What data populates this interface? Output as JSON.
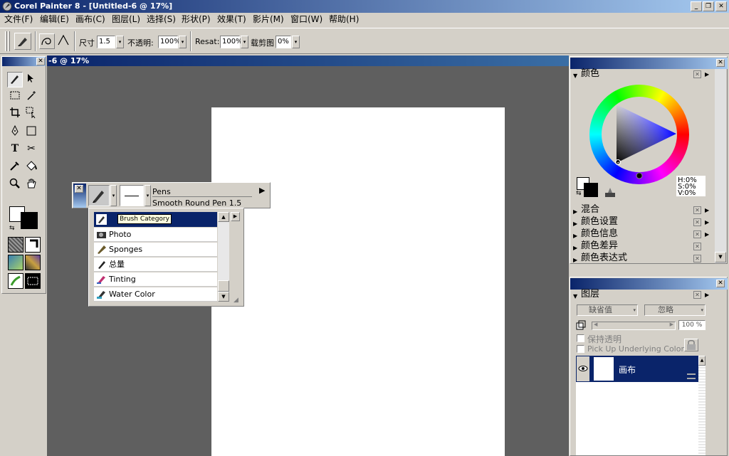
{
  "window": {
    "title": "Corel Painter 8 - [Untitled-6 @ 17%]",
    "controls": [
      "_",
      "❐",
      "✕"
    ]
  },
  "menu": [
    "文件(F)",
    "编辑(E)",
    "画布(C)",
    "图层(L)",
    "选择(S)",
    "形状(P)",
    "效果(T)",
    "影片(M)",
    "窗口(W)",
    "帮助(H)"
  ],
  "propbar": {
    "size_label": "尺寸",
    "size_value": "1.5",
    "opacity_label": "不透明:",
    "opacity_value": "100%",
    "resat_label": "Resat:",
    "resat_value": "100%",
    "bleed_label": "载剪图",
    "bleed_value": "0%"
  },
  "document": {
    "title": "-6 @ 17%"
  },
  "brush_selector": {
    "category": "Pens",
    "variant": "Smooth Round Pen 1.5",
    "tooltip": "Brush Category",
    "items": [
      "Photo",
      "Sponges",
      "总量",
      "Tinting",
      "Water Color"
    ]
  },
  "color_panel": {
    "title": "颜色",
    "hsv": {
      "h": "H:0%",
      "s": "S:0%",
      "v": "V:0%"
    },
    "sections": [
      "混合",
      "颜色设置",
      "颜色信息",
      "颜色差异",
      "颜色表达式"
    ]
  },
  "layers_panel": {
    "title": "图层",
    "composite_method": "缺省值",
    "depth": "忽略",
    "opacity": "100 %",
    "preserve_transparency": "保持透明",
    "pickup_underlying": "Pick Up Underlying Color",
    "layer_name": "画布"
  },
  "colors": {
    "titlebar": "#0a246a",
    "chrome": "#d4d0c8",
    "workspace": "#5f5f5f",
    "selection": "#0a246a"
  }
}
